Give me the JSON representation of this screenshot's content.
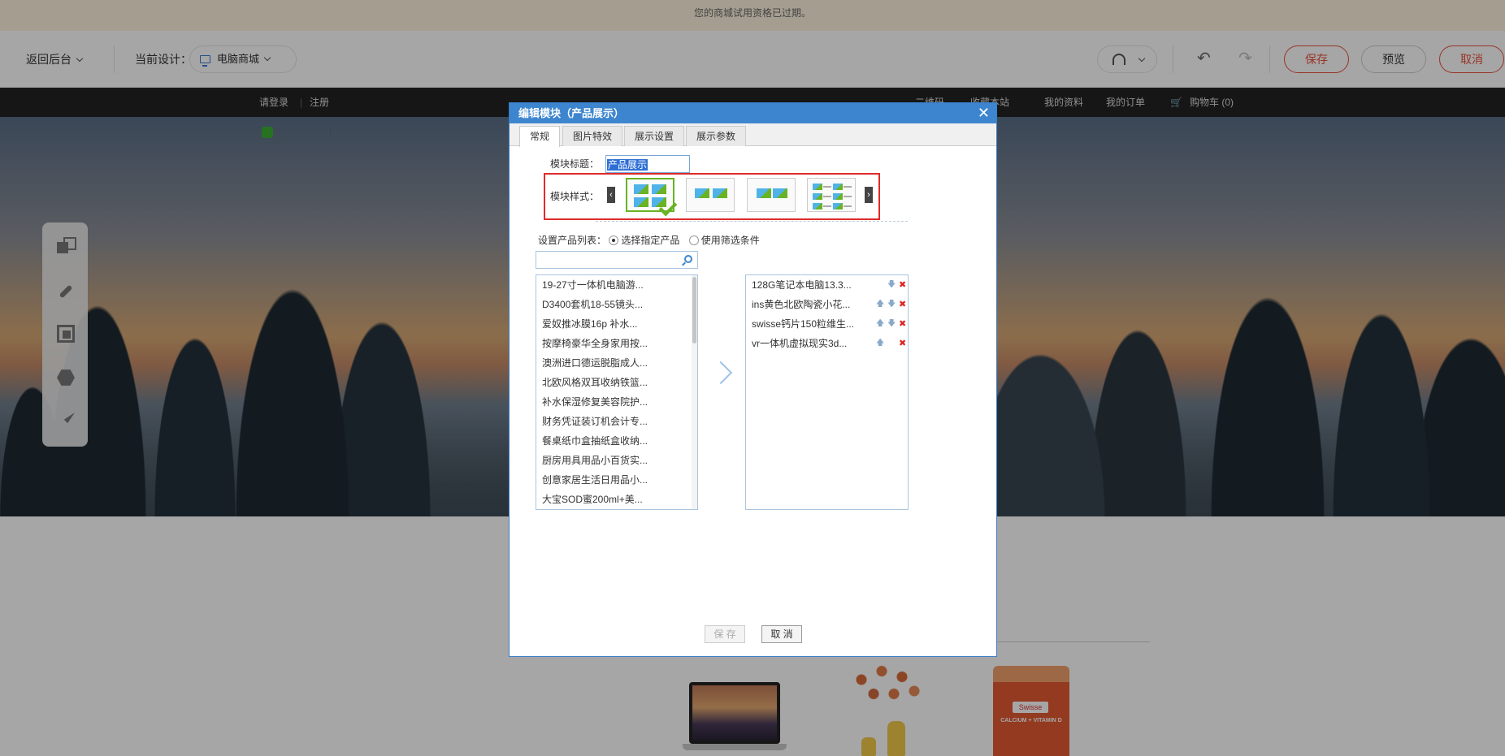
{
  "notice": {
    "text": "您的商城试用资格已过期。"
  },
  "toolbar": {
    "back_label": "返回后台",
    "current_design_label": "当前设计：",
    "design_value": "电脑商城",
    "save_label": "保存",
    "preview_label": "预览",
    "cancel_label": "取消"
  },
  "storebar": {
    "login": "请登录",
    "register": "注册",
    "qrcode": "二维码",
    "favorite": "收藏本站",
    "profile": "我的资料",
    "orders": "我的订单",
    "cart": "购物车 (0)"
  },
  "products": {
    "jar_brand": "Swisse",
    "jar_label": "CALCIUM + VITAMIN D"
  },
  "dialog": {
    "title": "编辑模块（产品展示）",
    "close": "✕",
    "tabs": [
      "常规",
      "图片特效",
      "展示设置",
      "展示参数"
    ],
    "module_title_label": "模块标题：",
    "module_title_value": "产品展示",
    "module_style_label": "模块样式：",
    "prev": "‹",
    "next": "›",
    "product_list_label": "设置产品列表：",
    "option_select": "选择指定产品",
    "option_filter": "使用筛选条件",
    "search_placeholder": "",
    "available": [
      "19-27寸一体机电脑游...",
      "D3400套机18-55镜头...",
      "爱奴推冰膜16p 补水...",
      "按摩椅豪华全身家用按...",
      "澳洲进口德运脱脂成人...",
      "北欧风格双耳收纳铁篮...",
      "补水保湿修复美容院护...",
      "财务凭证装订机会计专...",
      "餐桌纸巾盒抽纸盒收纳...",
      "厨房用具用品小百货实...",
      "创意家居生活日用品小...",
      "大宝SOD蜜200ml+美..."
    ],
    "selected": [
      "128G笔记本电脑13.3...",
      "ins黄色北欧陶瓷小花...",
      "swisse钙片150粒维生...",
      "vr一体机虚拟现实3d..."
    ],
    "up_icon": "🡅",
    "down_icon": "🡇",
    "delete_icon": "✖",
    "save_label": "保 存",
    "cancel_label": "取 消"
  }
}
